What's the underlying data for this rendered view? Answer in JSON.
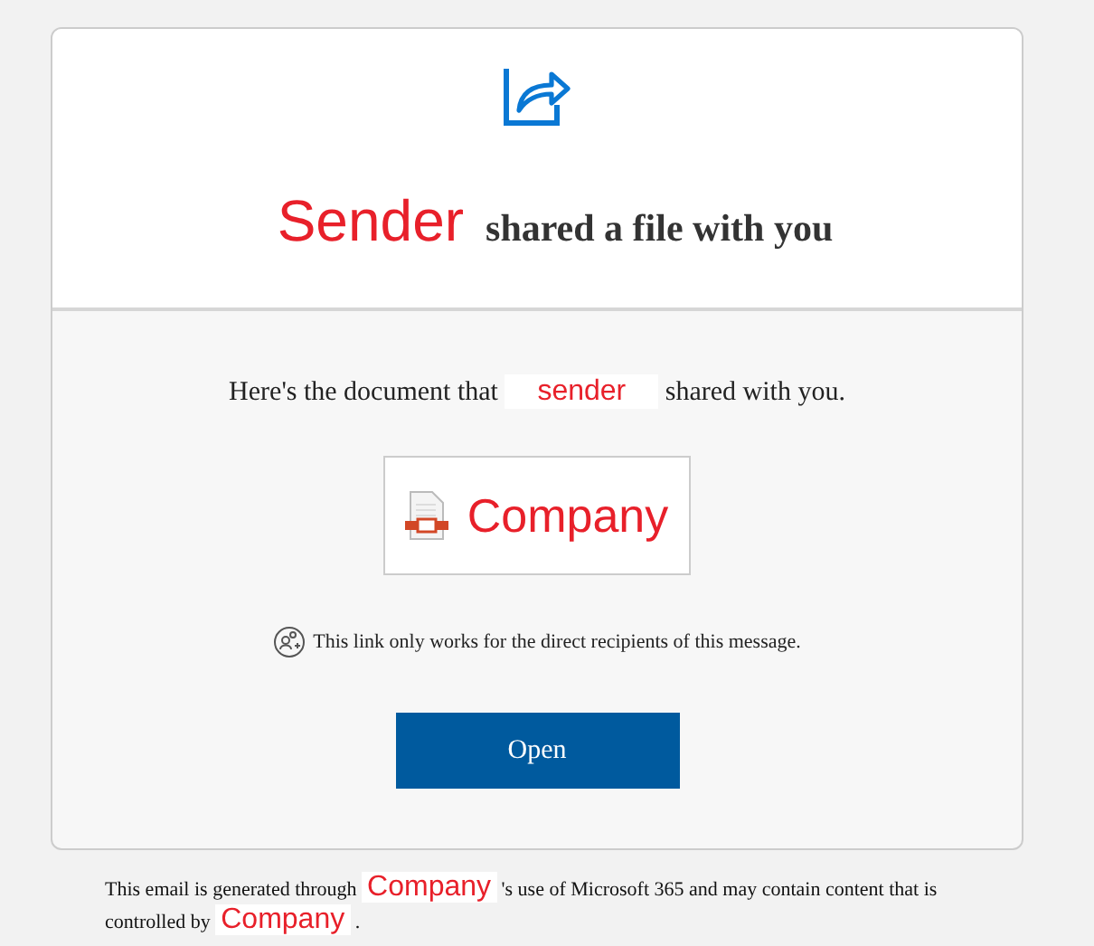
{
  "header": {
    "sender": "Sender",
    "title": "shared a file with you"
  },
  "message": {
    "before": "Here's the document that",
    "sender": "sender",
    "after": "shared with you."
  },
  "file": {
    "name": "Company"
  },
  "notice": "This link only works for the direct recipients of this message.",
  "open_button": "Open",
  "footer": {
    "part_1": "This email is generated through",
    "company_1": "Company",
    "part_2": "'s use of Microsoft 365 and may contain content that is controlled by",
    "company_2": "Company",
    "part_3": "."
  }
}
